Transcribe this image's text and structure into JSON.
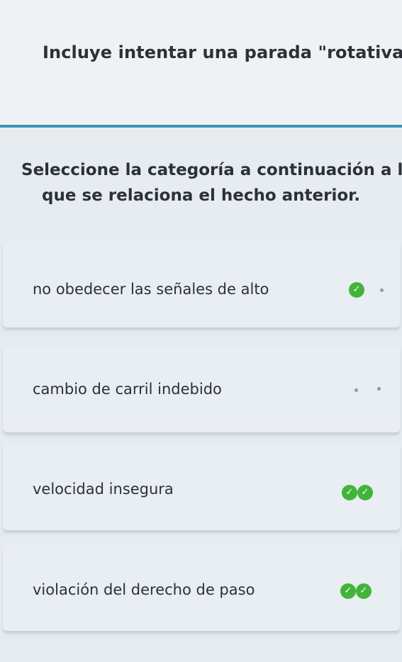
{
  "fact": {
    "text": "Incluye intentar una parada \"rotativa\""
  },
  "question": {
    "line1": "Seleccione la categoría a continuación a la",
    "line2": "que se relaciona el hecho anterior."
  },
  "options": [
    {
      "label": "no obedecer las señales de alto"
    },
    {
      "label": "cambio de carril indebido"
    },
    {
      "label": "velocidad insegura"
    },
    {
      "label": "violación del derecho de paso"
    }
  ],
  "colors": {
    "divider": "#3c92b4",
    "check": "#43b43a"
  },
  "icons": {
    "check": "check-circle-icon"
  }
}
